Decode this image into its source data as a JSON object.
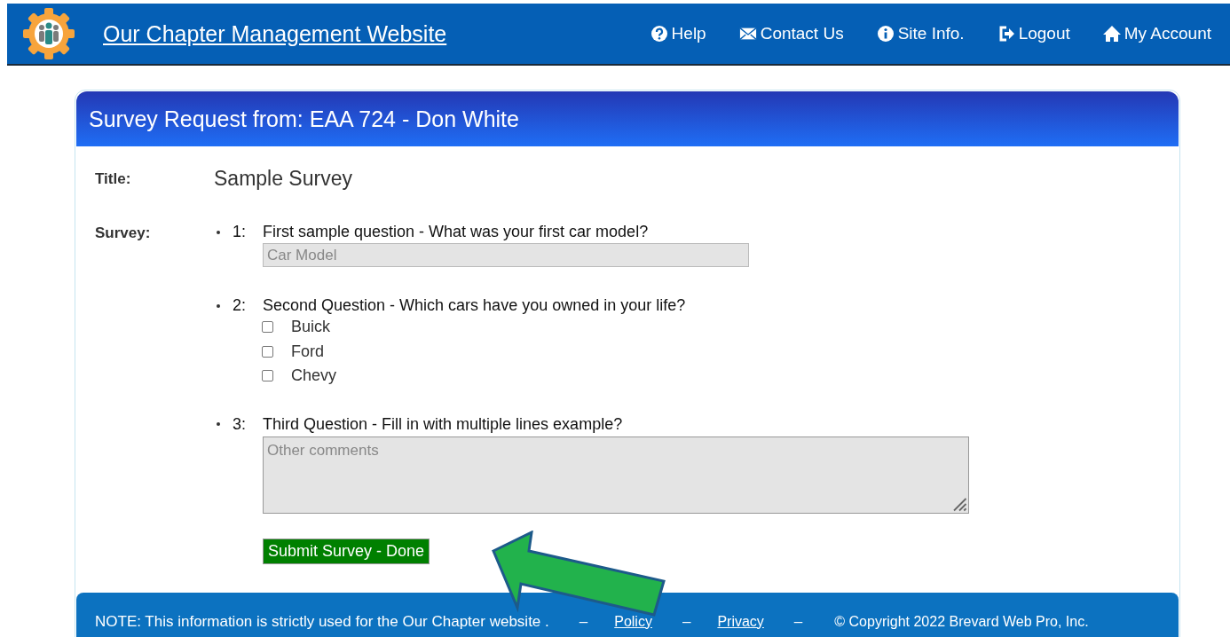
{
  "header": {
    "site_title": "Our Chapter Management Website",
    "nav": [
      {
        "label": "Help"
      },
      {
        "label": "Contact Us"
      },
      {
        "label": "Site Info."
      },
      {
        "label": "Logout"
      },
      {
        "label": "My Account"
      }
    ]
  },
  "card": {
    "heading": "Survey Request from: EAA 724 - Don White",
    "title_label": "Title:",
    "title_value": "Sample Survey",
    "survey_label": "Survey:",
    "questions": [
      {
        "number": "1:",
        "text": "First sample question - What was your first car model?",
        "kind": "text",
        "placeholder": "Car Model"
      },
      {
        "number": "2:",
        "text": "Second Question - Which cars have you owned in your life?",
        "kind": "checkboxes",
        "options": [
          {
            "label": "Buick",
            "checked": false
          },
          {
            "label": "Ford",
            "checked": false
          },
          {
            "label": "Chevy",
            "checked": false
          }
        ]
      },
      {
        "number": "3:",
        "text": "Third Question - Fill in with multiple lines example?",
        "kind": "textarea",
        "placeholder": "Other comments"
      }
    ],
    "submit": "Submit Survey - Done"
  },
  "footer": {
    "note": "NOTE: This information is strictly used for the Our Chapter website .",
    "separators": [
      "–",
      "–",
      "–"
    ],
    "policy": "Policy",
    "privacy": "Privacy",
    "copyright": "© Copyright 2022 Brevard Web Pro, Inc."
  }
}
